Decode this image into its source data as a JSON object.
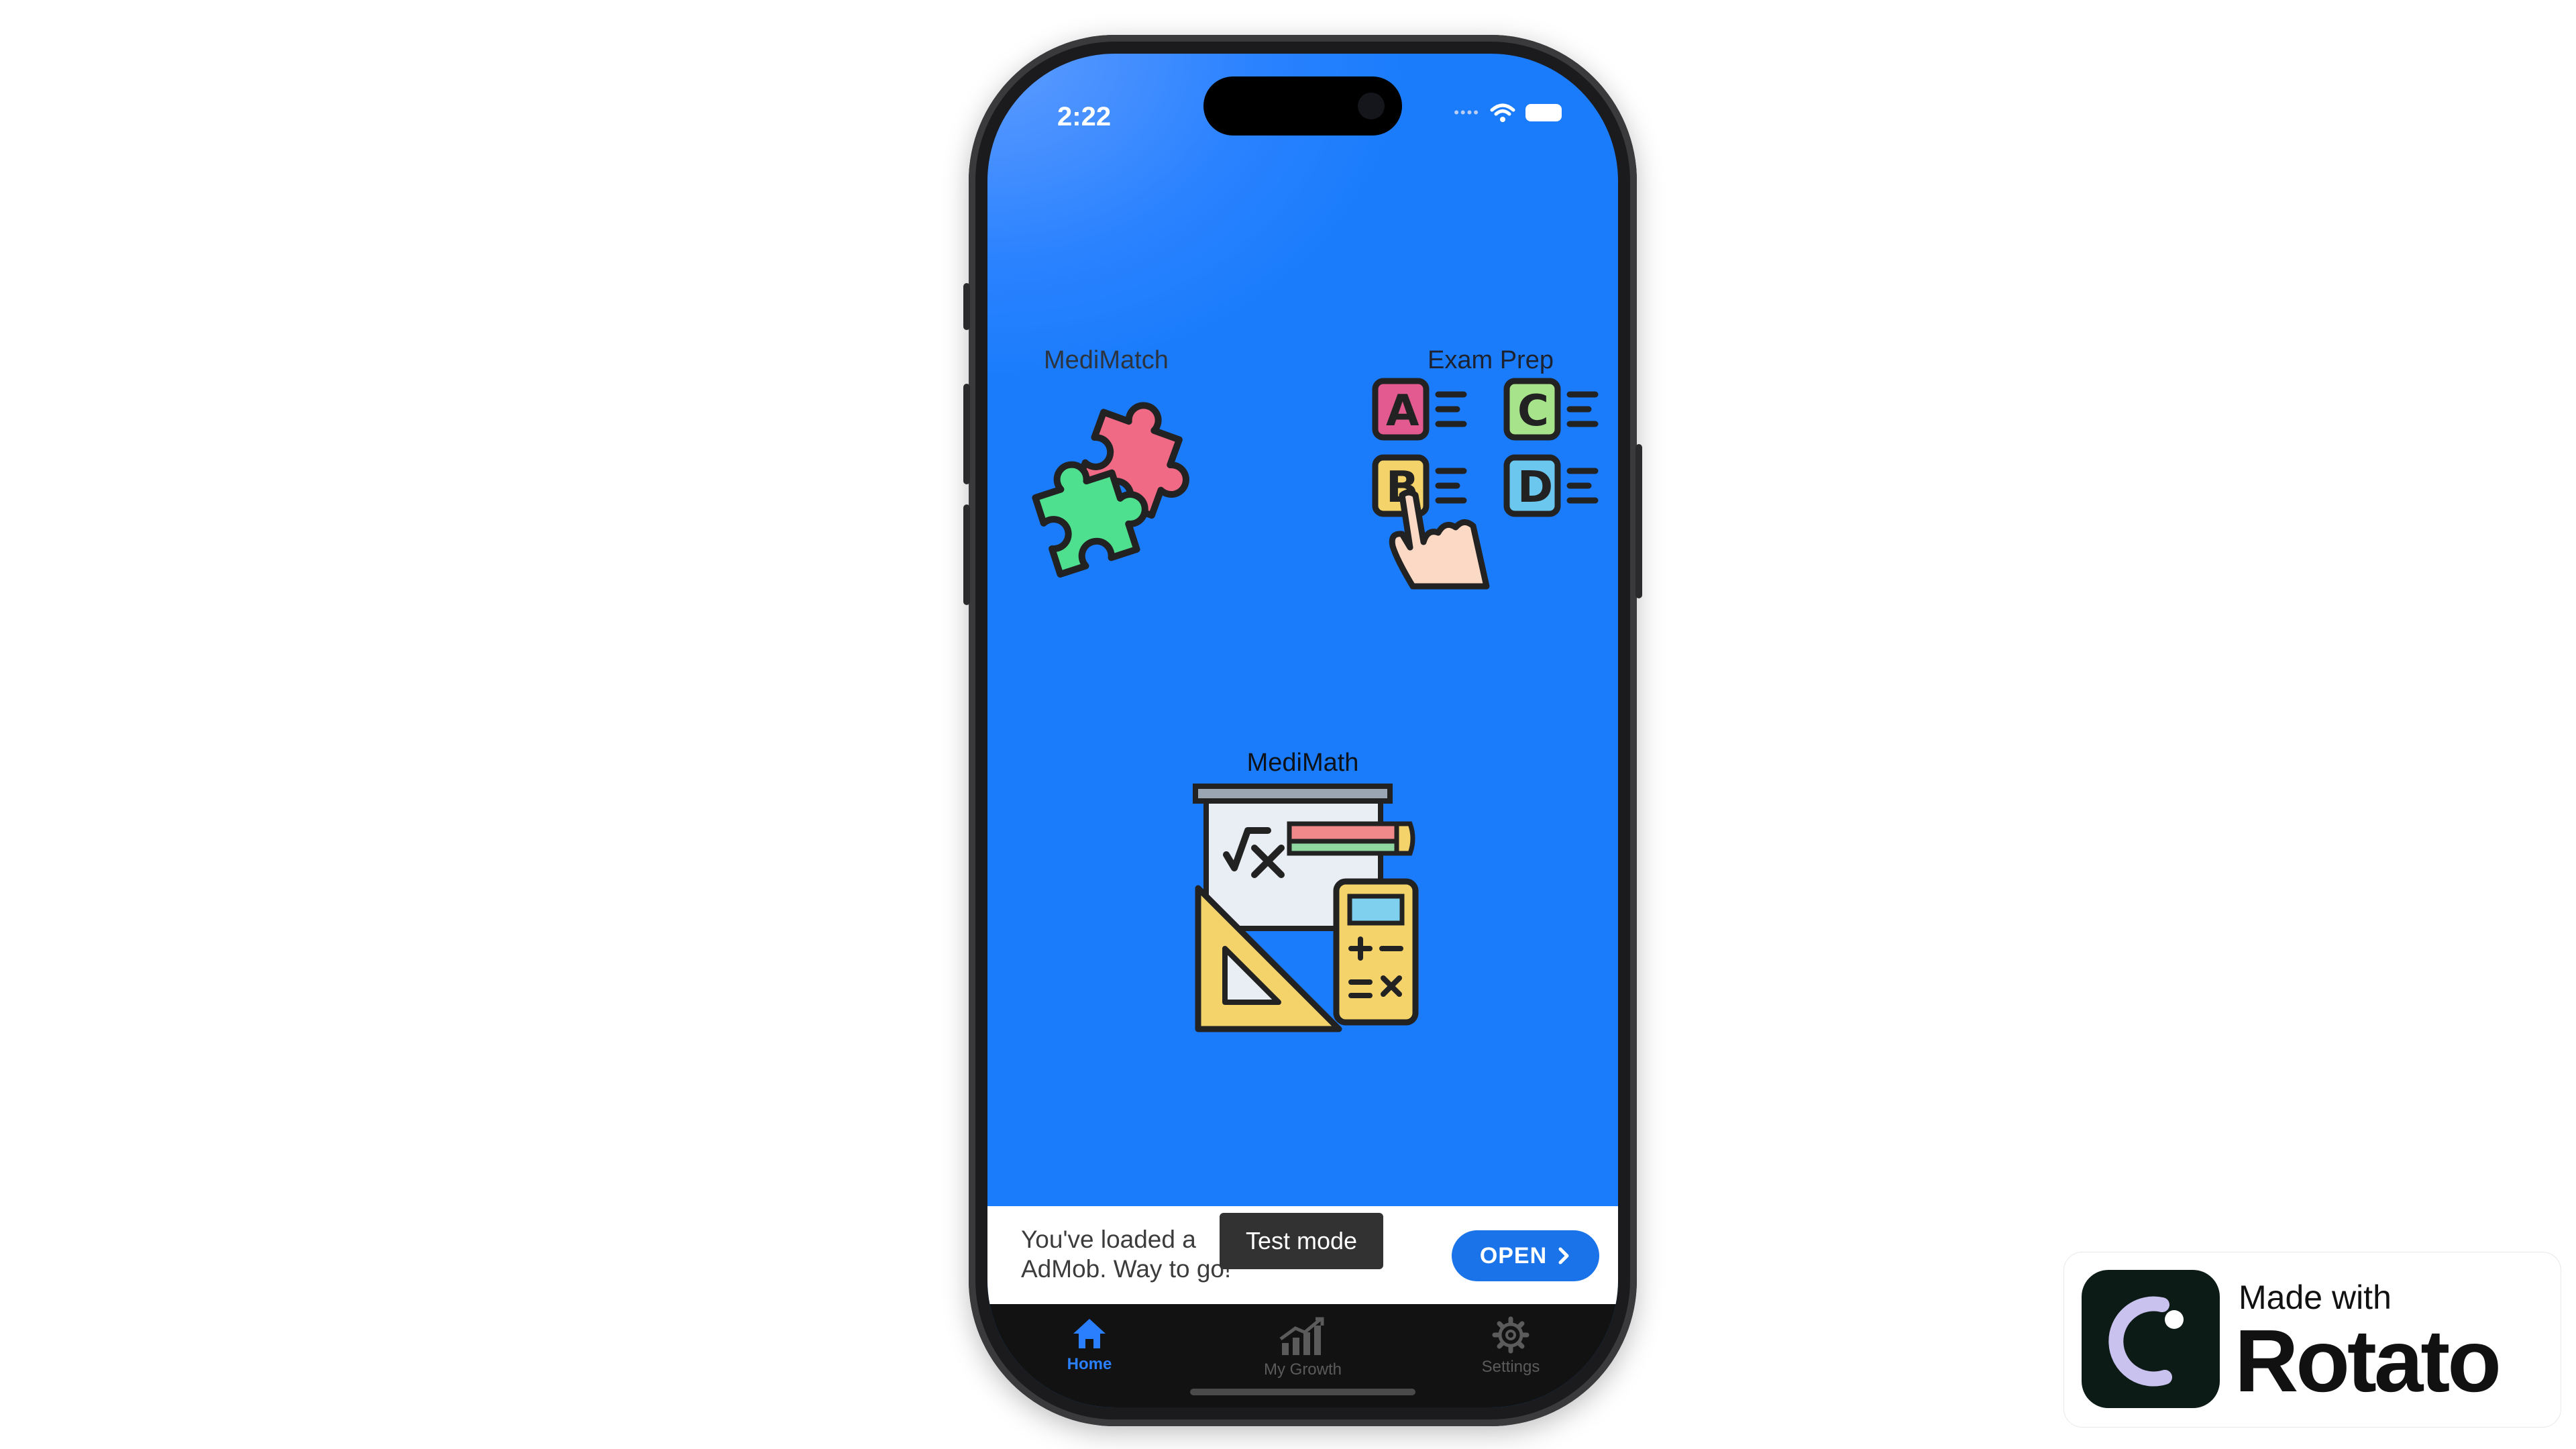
{
  "status_bar": {
    "time": "2:22"
  },
  "tiles": {
    "medimatch": {
      "label": "MediMatch"
    },
    "exam_prep": {
      "label": "Exam Prep",
      "options": [
        "A",
        "B",
        "C",
        "D"
      ]
    },
    "medimath": {
      "label": "MediMath"
    }
  },
  "ad": {
    "text": "You've loaded a AdMob. Way to go!",
    "toast": "Test mode",
    "open_label": "OPEN"
  },
  "tab_bar": {
    "items": [
      {
        "label": "Home",
        "icon": "home-icon",
        "active": true
      },
      {
        "label": "My Growth",
        "icon": "growth-chart-icon",
        "active": false
      },
      {
        "label": "Settings",
        "icon": "gear-icon",
        "active": false
      }
    ]
  },
  "badge": {
    "made_with": "Made with",
    "brand": "Rotato"
  },
  "colors": {
    "screen_bg": "#1a7cfb",
    "tab_active": "#2a7fff",
    "tab_inactive": "#5b5b5b",
    "ad_button": "#1a73e8"
  }
}
